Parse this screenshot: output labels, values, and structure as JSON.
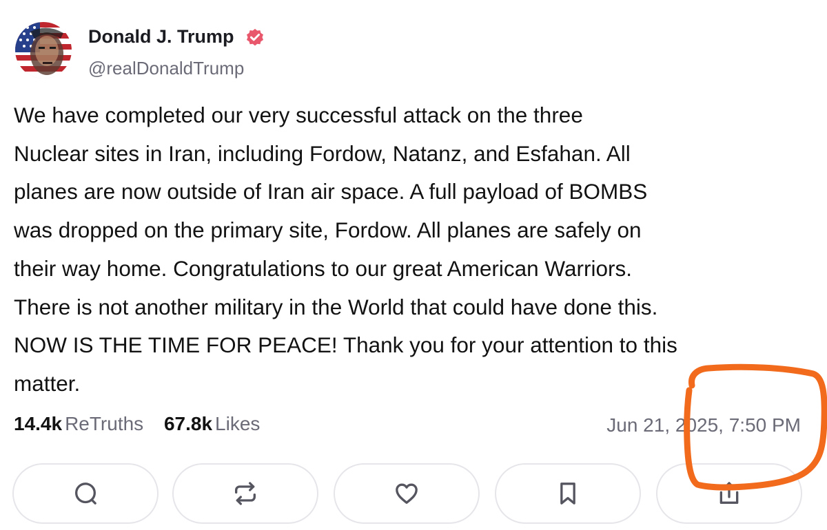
{
  "author": {
    "display_name": "Donald J. Trump",
    "handle": "@realDonaldTrump",
    "verified": true
  },
  "post": {
    "lines": [
      "We have completed our very successful attack on the three",
      "Nuclear sites in Iran, including Fordow, Natanz, and Esfahan. All",
      "planes are now outside of Iran air space. A full payload of BOMBS",
      "was dropped on the primary site, Fordow. All planes are safely on",
      "their way home. Congratulations to our great American Warriors.",
      "There is not another military in the World that could have done this.",
      "NOW IS THE TIME FOR PEACE! Thank you for your attention to this",
      "matter."
    ],
    "retruths_count": "14.4k",
    "retruths_label": "ReTruths",
    "likes_count": "67.8k",
    "likes_label": "Likes",
    "timestamp": "Jun 21, 2025, 7:50 PM"
  },
  "actions": [
    {
      "name": "reply",
      "icon": "speech-bubble-icon"
    },
    {
      "name": "retruth",
      "icon": "repost-arrows-icon"
    },
    {
      "name": "like",
      "icon": "heart-icon"
    },
    {
      "name": "bookmark",
      "icon": "bookmark-icon"
    },
    {
      "name": "share",
      "icon": "share-icon"
    }
  ],
  "colors": {
    "verified_badge": "#e8576c",
    "muted_text": "#6b6b78",
    "icon_stroke": "#555560",
    "button_border": "#e5e5ea",
    "annotation_stroke": "#f26b1d"
  }
}
